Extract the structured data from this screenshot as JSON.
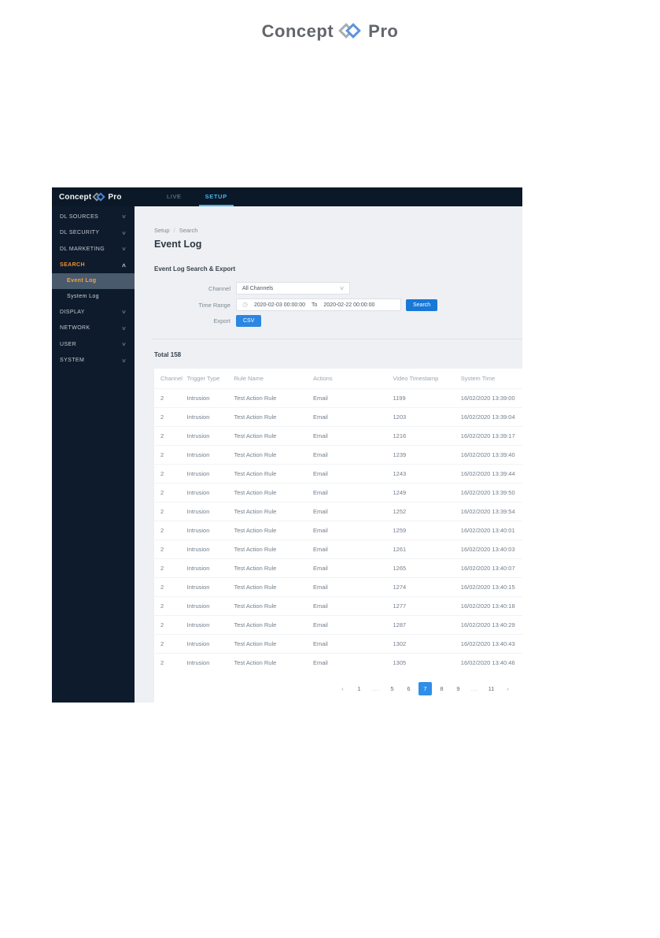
{
  "colors": {
    "navy": "#0b1827",
    "sidebar_navy": "#0e1b2c",
    "accent_blue": "#2f8ee8",
    "tab_active_blue": "#47b4e9",
    "orange": "#ee8f33",
    "selected_item_bg": "#4a5a6d",
    "content_bg": "#eef0f3",
    "logo_gray": "#a8aeb4",
    "logo_blue": "#5d93d8"
  },
  "page": {
    "logo": {
      "part1": "Concept",
      "part2": "Pro"
    }
  },
  "app": {
    "navbar": {
      "logo": {
        "part1": "Concept",
        "part2": "Pro"
      },
      "tabs": [
        {
          "label": "LIVE",
          "active": false
        },
        {
          "label": "SETUP",
          "active": true
        }
      ]
    },
    "sidebar": {
      "items": [
        {
          "label": "DL SOURCES",
          "chevron": "down"
        },
        {
          "label": "DL SECURITY",
          "chevron": "down"
        },
        {
          "label": "DL MARKETING",
          "chevron": "down"
        },
        {
          "label": "SEARCH",
          "chevron": "up",
          "active": true
        },
        {
          "label": "Event Log",
          "sub": true,
          "selected": true
        },
        {
          "label": "System Log",
          "sub": true
        },
        {
          "label": "DISPLAY",
          "chevron": "down"
        },
        {
          "label": "NETWORK",
          "chevron": "down"
        },
        {
          "label": "USER",
          "chevron": "down"
        },
        {
          "label": "SYSTEM",
          "chevron": "down"
        }
      ]
    },
    "content": {
      "breadcrumb": {
        "first": "Setup",
        "separator": "/",
        "second": "Search"
      },
      "title": "Event Log",
      "section_title": "Event Log Search & Export",
      "form": {
        "channel_label": "Channel",
        "channel_value": "All Channels",
        "time_range_label": "Time Range",
        "time_from": "2020-02-03 00:00:00",
        "time_separator": "To",
        "time_to": "2020-02-22 00:00:00",
        "search_button": "Search",
        "export_label": "Export",
        "csv_button": "CSV"
      },
      "total_label": "Total 158",
      "table": {
        "headers": [
          "Channel",
          "Trigger Type",
          "Rule Name",
          "Actions",
          "Video Timestamp",
          "System Time"
        ],
        "rows": [
          [
            "2",
            "Intrusion",
            "Test Action Rule",
            "Email",
            "1199",
            "16/02/2020 13:39:00"
          ],
          [
            "2",
            "Intrusion",
            "Test Action Rule",
            "Email",
            "1203",
            "16/02/2020 13:39:04"
          ],
          [
            "2",
            "Intrusion",
            "Test Action Rule",
            "Email",
            "1216",
            "16/02/2020 13:39:17"
          ],
          [
            "2",
            "Intrusion",
            "Test Action Rule",
            "Email",
            "1239",
            "16/02/2020 13:39:40"
          ],
          [
            "2",
            "Intrusion",
            "Test Action Rule",
            "Email",
            "1243",
            "16/02/2020 13:39:44"
          ],
          [
            "2",
            "Intrusion",
            "Test Action Rule",
            "Email",
            "1249",
            "16/02/2020 13:39:50"
          ],
          [
            "2",
            "Intrusion",
            "Test Action Rule",
            "Email",
            "1252",
            "16/02/2020 13:39:54"
          ],
          [
            "2",
            "Intrusion",
            "Test Action Rule",
            "Email",
            "1259",
            "16/02/2020 13:40:01"
          ],
          [
            "2",
            "Intrusion",
            "Test Action Rule",
            "Email",
            "1261",
            "16/02/2020 13:40:03"
          ],
          [
            "2",
            "Intrusion",
            "Test Action Rule",
            "Email",
            "1265",
            "16/02/2020 13:40:07"
          ],
          [
            "2",
            "Intrusion",
            "Test Action Rule",
            "Email",
            "1274",
            "16/02/2020 13:40:15"
          ],
          [
            "2",
            "Intrusion",
            "Test Action Rule",
            "Email",
            "1277",
            "16/02/2020 13:40:18"
          ],
          [
            "2",
            "Intrusion",
            "Test Action Rule",
            "Email",
            "1287",
            "16/02/2020 13:40:29"
          ],
          [
            "2",
            "Intrusion",
            "Test Action Rule",
            "Email",
            "1302",
            "16/02/2020 13:40:43"
          ],
          [
            "2",
            "Intrusion",
            "Test Action Rule",
            "Email",
            "1305",
            "16/02/2020 13:40:46"
          ]
        ]
      },
      "pagination": {
        "items": [
          {
            "label": "‹",
            "type": "prev"
          },
          {
            "label": "1"
          },
          {
            "label": "...",
            "type": "ellipsis"
          },
          {
            "label": "5"
          },
          {
            "label": "6"
          },
          {
            "label": "7",
            "active": true
          },
          {
            "label": "8"
          },
          {
            "label": "9"
          },
          {
            "label": "...",
            "type": "ellipsis"
          },
          {
            "label": "11"
          },
          {
            "label": "›",
            "type": "next"
          }
        ]
      }
    }
  }
}
